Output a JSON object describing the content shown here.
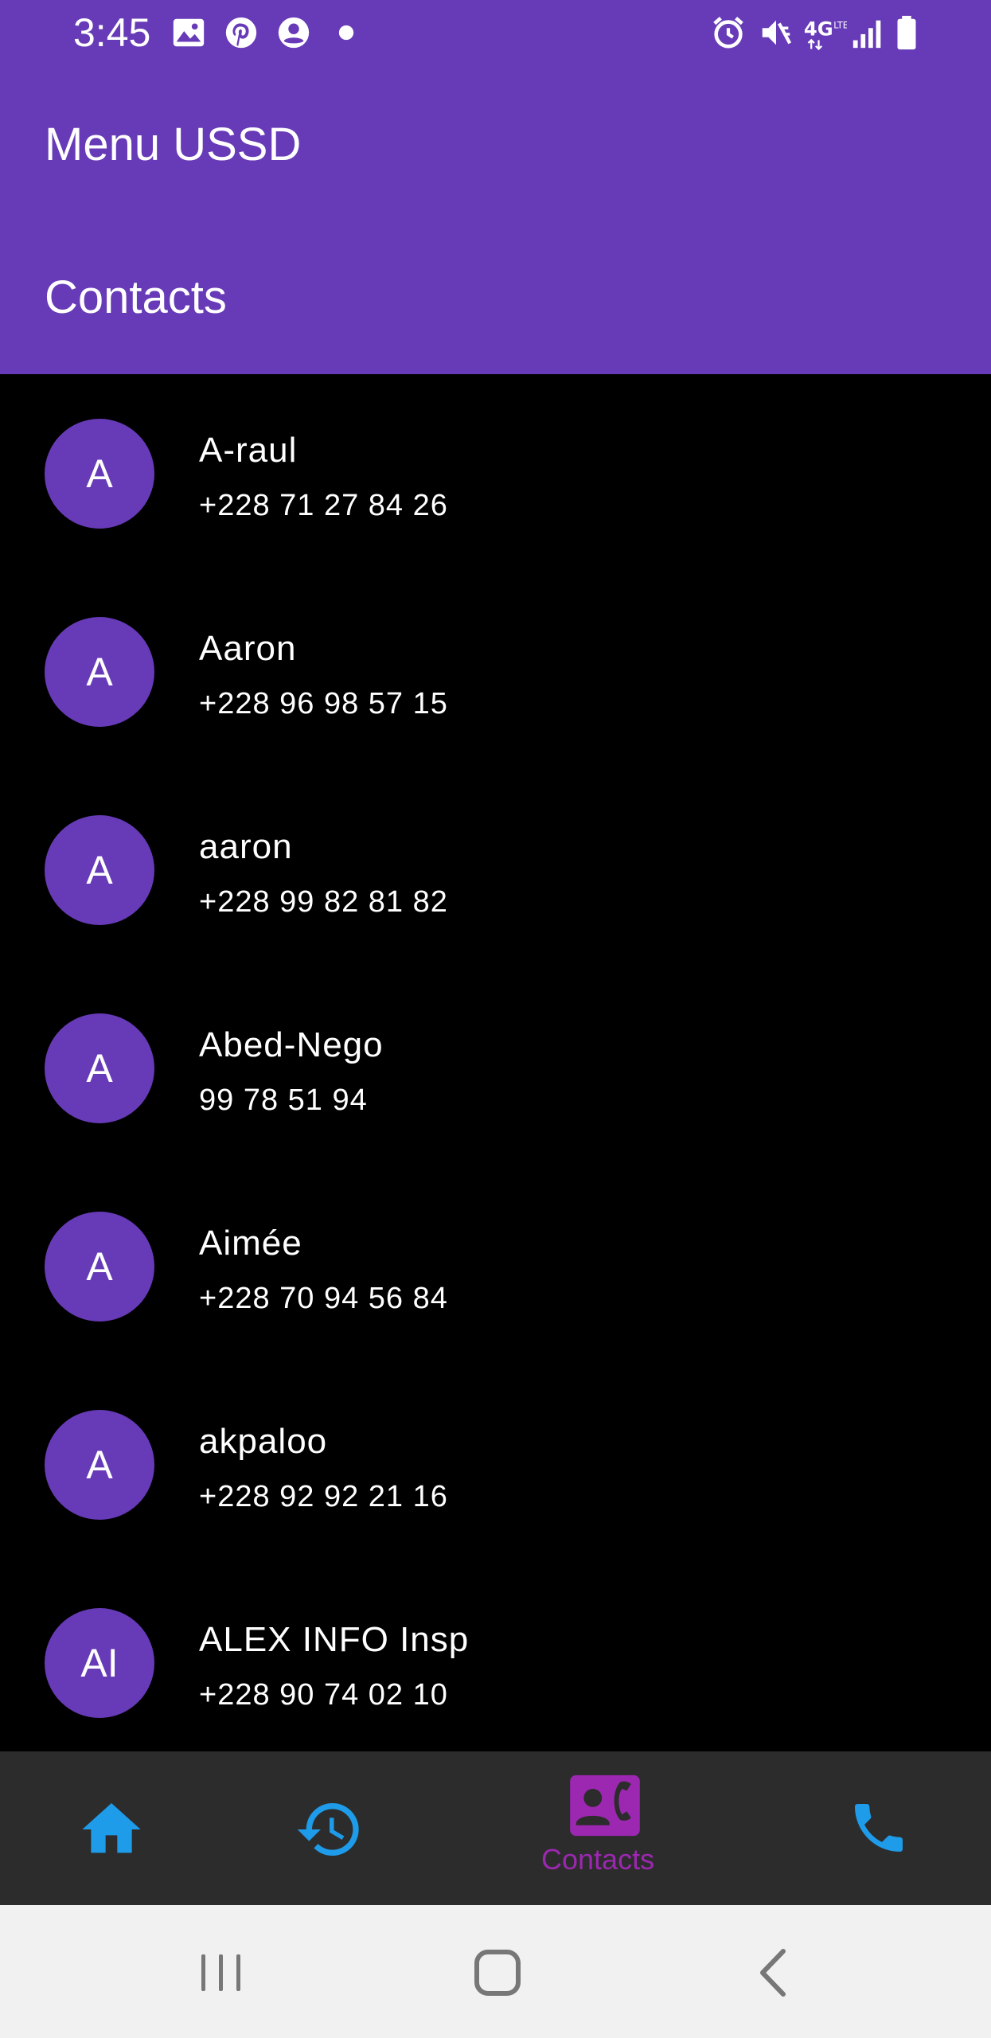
{
  "status_bar": {
    "time": "3:45",
    "left_icons": [
      "gallery-icon",
      "pinterest-icon",
      "account-icon",
      "dot-icon"
    ],
    "right_icons": [
      "alarm-icon",
      "vibrate-mute-icon",
      "4g-lte-icon",
      "signal-icon",
      "battery-icon"
    ],
    "network_label": "4G"
  },
  "app_bar": {
    "title": "Menu USSD",
    "section": "Contacts"
  },
  "contacts": [
    {
      "initials": "A",
      "name": "A-raul",
      "phone": "+228 71 27 84 26"
    },
    {
      "initials": "A",
      "name": "Aaron",
      "phone": "+228 96 98 57 15"
    },
    {
      "initials": "A",
      "name": "aaron",
      "phone": "+228 99 82 81 82"
    },
    {
      "initials": "A",
      "name": "Abed-Nego",
      "phone": "99 78 51 94"
    },
    {
      "initials": "A",
      "name": "Aimée",
      "phone": "+228 70 94 56 84"
    },
    {
      "initials": "A",
      "name": "akpaloo",
      "phone": "+228 92 92 21 16"
    },
    {
      "initials": "AI",
      "name": "ALEX INFO Insp",
      "phone": "+228 90 74 02 10"
    }
  ],
  "bottom_nav": {
    "items": [
      {
        "icon": "home-icon",
        "label": ""
      },
      {
        "icon": "history-icon",
        "label": ""
      },
      {
        "icon": "contacts-icon",
        "label": "Contacts",
        "selected": true
      },
      {
        "icon": "phone-icon",
        "label": ""
      }
    ],
    "colors": {
      "inactive": "#1E9BE9",
      "active": "#9C27B0"
    }
  },
  "system_nav": {
    "buttons": [
      "recents-icon",
      "home-button-icon",
      "back-icon"
    ]
  },
  "colors": {
    "primary": "#673AB7",
    "background": "#000000",
    "nav_background": "#2c2c2c"
  }
}
